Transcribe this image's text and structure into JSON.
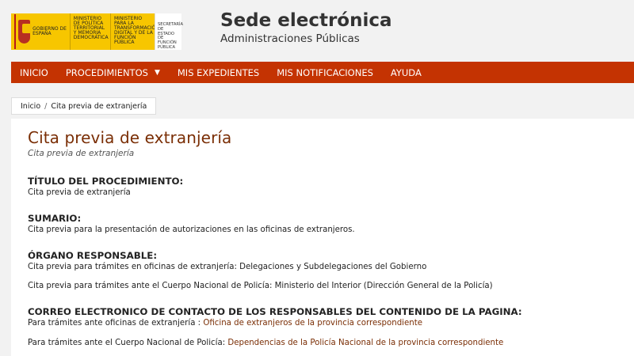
{
  "header": {
    "logo": {
      "gov_text": "GOBIERNO DE ESPAÑA",
      "ministry1": "MINISTERIO DE POLÍTICA TERRITORIAL Y MEMORIA DEMOCRÁTICA",
      "ministry2": "MINISTERIO PARA LA TRANSFORMACIÓN DIGITAL Y DE LA FUNCIÓN PÚBLICA",
      "secretariat": "SECRETARÍA DE ESTADO DE FUNCIÓN PÚBLICA"
    },
    "title": "Sede electrónica",
    "subtitle": "Administraciones Públicas"
  },
  "nav": {
    "items": [
      "INICIO",
      "PROCEDIMIENTOS",
      "MIS EXPEDIENTES",
      "MIS NOTIFICACIONES",
      "AYUDA"
    ],
    "caret": "▼"
  },
  "breadcrumb": {
    "home": "Inicio",
    "separator": "/",
    "current": "Cita previa de extranjería"
  },
  "page": {
    "title": "Cita previa de extranjería",
    "subtitle": "Cita previa de extranjería",
    "sections": {
      "titulo": {
        "heading": "TÍTULO DEL PROCEDIMIENTO:",
        "text": "Cita previa de extranjería"
      },
      "sumario": {
        "heading": "SUMARIO:",
        "text": "Cita previa para la presentación de autorizaciones en las oficinas de extranjeros."
      },
      "organo": {
        "heading": "ÓRGANO RESPONSABLE:",
        "line1": "Cita previa para trámites en oficinas de extranjería: Delegaciones y Subdelegaciones del Gobierno",
        "line2": "Cita previa para trámites ante el Cuerpo Nacional de Policía: Ministerio del Interior (Dirección General de la Policía)"
      },
      "correo": {
        "heading": "CORREO ELECTRONICO DE CONTACTO DE LOS RESPONSABLES DEL CONTENIDO DE LA PAGINA:",
        "line1_prefix": "Para trámites ante oficinas de extranjería : ",
        "line1_link": "Oficina de extranjeros de la provincia correspondiente",
        "line2_prefix": "Para trámites ante el Cuerpo Nacional de Policía: ",
        "line2_link": "Dependencias de la Policía Nacional de la provincia correspondiente"
      }
    }
  },
  "colors": {
    "nav_bg": "#c43302",
    "title_color": "#7a2e05",
    "link_color": "#7a2e05",
    "logo_yellow": "#f7c600"
  }
}
